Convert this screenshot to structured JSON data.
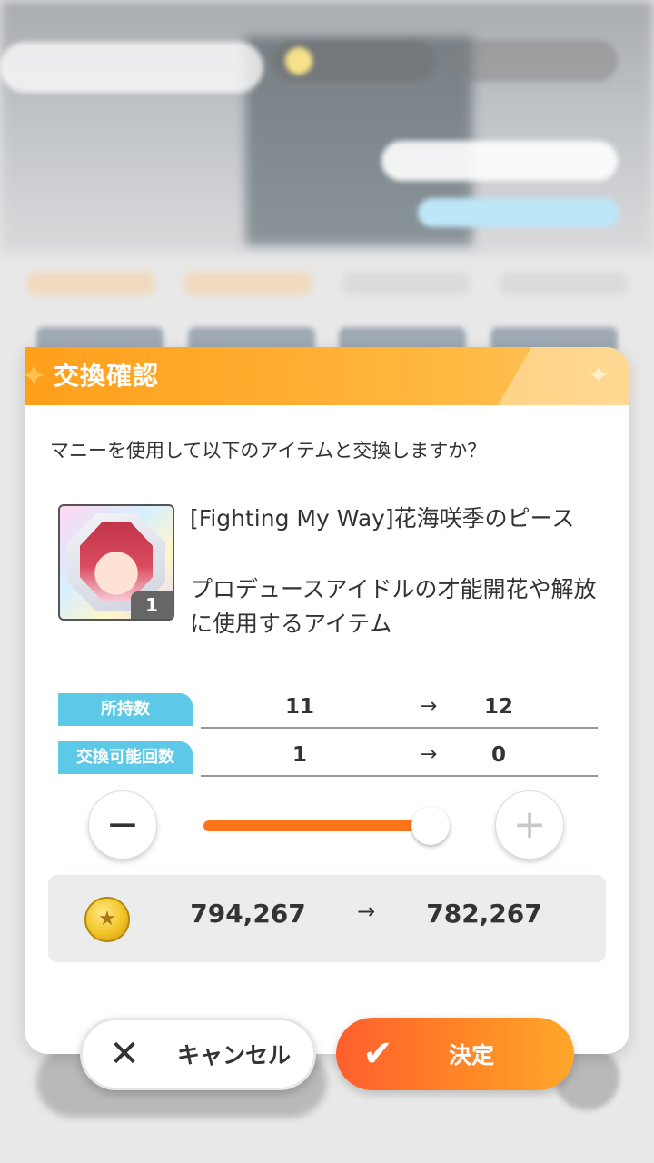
{
  "dialog": {
    "title": "交換確認",
    "question": "マニーを使用して以下のアイテムと交換しますか？",
    "item": {
      "name": "[Fighting My Way]花海咲季のピース",
      "description": "プロデュースアイドルの才能開花や解放に使用するアイテム",
      "count_badge": "1"
    },
    "stats": [
      {
        "label": "所持数",
        "from": "11",
        "arrow": "→",
        "to": "12"
      },
      {
        "label": "交換可能回数",
        "from": "1",
        "arrow": "→",
        "to": "0"
      }
    ],
    "quantity_slider": {
      "value_fraction": 1.0
    },
    "cost": {
      "from": "794,267",
      "arrow": "→",
      "to": "782,267"
    }
  },
  "buttons": {
    "cancel_label": "キャンセル",
    "confirm_label": "決定"
  },
  "icons": {
    "header_sparkle": "sparkle-icon",
    "minus": "minus-icon",
    "plus": "plus-icon",
    "coin": "money-coin-icon",
    "cancel": "close-icon",
    "confirm": "check-icon"
  },
  "colors": {
    "header": "#ffa62a",
    "stat_label": "#5cc9e6",
    "slider": "#ff7418",
    "confirm": "#ff7a2a"
  }
}
